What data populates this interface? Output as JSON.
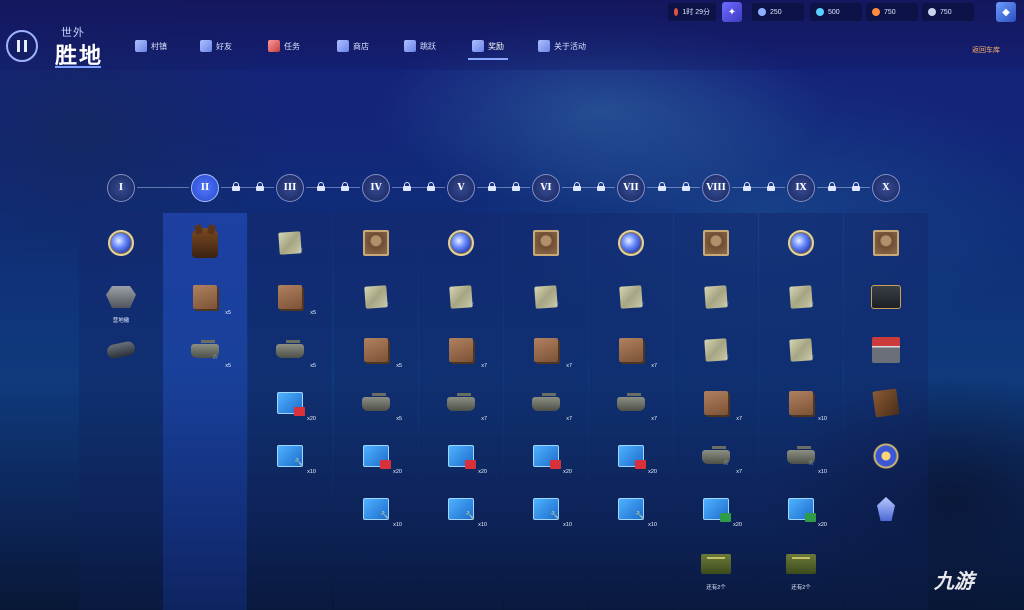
{
  "header": {
    "brand_sub": "世外",
    "brand_main": "胜地",
    "exit_label": "返回车库"
  },
  "nav": [
    {
      "label": "村镇",
      "icon": "village-icon"
    },
    {
      "label": "好友",
      "icon": "friends-icon"
    },
    {
      "label": "任务",
      "icon": "tasks-icon"
    },
    {
      "label": "商店",
      "icon": "shop-icon"
    },
    {
      "label": "跳跃",
      "icon": "jump-icon"
    },
    {
      "label": "奖励",
      "icon": "medal-icon",
      "active": true
    },
    {
      "label": "关于活动",
      "icon": "info-icon"
    }
  ],
  "resources": {
    "timer": "1时 29分",
    "res1": "250",
    "res2": "500",
    "res3": "750",
    "res4": "750"
  },
  "tiers": [
    "I",
    "II",
    "III",
    "IV",
    "V",
    "VI",
    "VII",
    "VIII",
    "IX",
    "X"
  ],
  "current_tier": "II",
  "columns": [
    {
      "tier": "I",
      "items": [
        {
          "type": "medal",
          "name": "medal-icon"
        },
        {
          "type": "emblem",
          "name": "emblem-icon",
          "label": "营地徽"
        },
        {
          "type": "barrel",
          "name": "barrel-icon"
        }
      ]
    },
    {
      "tier": "II",
      "items": [
        {
          "type": "dog",
          "name": "dog-icon"
        },
        {
          "type": "crate",
          "name": "crate-icon",
          "qty": "x5"
        },
        {
          "type": "tank",
          "name": "tank-icon",
          "qty": "x5",
          "star": true
        }
      ]
    },
    {
      "tier": "III",
      "items": [
        {
          "type": "map",
          "name": "map-icon",
          "star": true
        },
        {
          "type": "crate",
          "name": "crate-icon",
          "qty": "x5"
        },
        {
          "type": "tank",
          "name": "tank-icon",
          "qty": "x5"
        },
        {
          "type": "blueprint",
          "badge": "red",
          "name": "blueprint-icon",
          "qty": "x20"
        },
        {
          "type": "blueprint",
          "badge": "wrench",
          "name": "blueprint-wrench-icon",
          "qty": "x10"
        }
      ]
    },
    {
      "tier": "IV",
      "items": [
        {
          "type": "portrait",
          "name": "portrait-icon"
        },
        {
          "type": "map",
          "name": "map-icon",
          "star": true
        },
        {
          "type": "crate",
          "name": "crate-icon",
          "qty": "x5"
        },
        {
          "type": "tank",
          "name": "tank-icon",
          "qty": "x5"
        },
        {
          "type": "blueprint",
          "badge": "red",
          "name": "blueprint-icon",
          "qty": "x20"
        },
        {
          "type": "blueprint",
          "badge": "wrench",
          "name": "blueprint-wrench-icon",
          "qty": "x10"
        }
      ]
    },
    {
      "tier": "V",
      "items": [
        {
          "type": "medal",
          "name": "medal-icon"
        },
        {
          "type": "map",
          "name": "map-icon",
          "star": true
        },
        {
          "type": "crate",
          "name": "crate-icon",
          "qty": "x7"
        },
        {
          "type": "tank",
          "name": "tank-icon",
          "qty": "x7"
        },
        {
          "type": "blueprint",
          "badge": "red",
          "name": "blueprint-icon",
          "qty": "x20"
        },
        {
          "type": "blueprint",
          "badge": "wrench",
          "name": "blueprint-wrench-icon",
          "qty": "x10"
        }
      ]
    },
    {
      "tier": "VI",
      "items": [
        {
          "type": "portrait",
          "name": "portrait-icon"
        },
        {
          "type": "map",
          "name": "map-icon",
          "star": true
        },
        {
          "type": "crate",
          "name": "crate-icon",
          "qty": "x7"
        },
        {
          "type": "tank",
          "name": "tank-icon",
          "qty": "x7"
        },
        {
          "type": "blueprint",
          "badge": "red",
          "name": "blueprint-icon",
          "qty": "x20"
        },
        {
          "type": "blueprint",
          "badge": "wrench",
          "name": "blueprint-wrench-icon",
          "qty": "x10"
        }
      ]
    },
    {
      "tier": "VII",
      "items": [
        {
          "type": "medal",
          "name": "medal-icon"
        },
        {
          "type": "map",
          "name": "map-icon",
          "star": true
        },
        {
          "type": "crate",
          "name": "crate-icon",
          "qty": "x7"
        },
        {
          "type": "tank",
          "name": "tank-icon",
          "qty": "x7"
        },
        {
          "type": "blueprint",
          "badge": "red",
          "name": "blueprint-icon",
          "qty": "x20"
        },
        {
          "type": "blueprint",
          "badge": "wrench",
          "name": "blueprint-wrench-icon",
          "qty": "x10"
        }
      ]
    },
    {
      "tier": "VIII",
      "items": [
        {
          "type": "portrait",
          "name": "portrait-icon"
        },
        {
          "type": "map",
          "name": "map-icon",
          "star": true
        },
        {
          "type": "map",
          "name": "map-icon",
          "star": true
        },
        {
          "type": "crate",
          "name": "crate-icon",
          "qty": "x7"
        },
        {
          "type": "tank",
          "name": "tank-icon",
          "qty": "x7",
          "star": true
        },
        {
          "type": "blueprint",
          "badge": "green",
          "name": "blueprint-icon",
          "qty": "x20"
        },
        {
          "type": "ammo",
          "name": "ammo-box-icon",
          "label": "还有2个"
        }
      ]
    },
    {
      "tier": "IX",
      "items": [
        {
          "type": "medal",
          "name": "medal-icon"
        },
        {
          "type": "map",
          "name": "map-icon",
          "star": true
        },
        {
          "type": "map",
          "name": "map-icon",
          "star": true
        },
        {
          "type": "crate",
          "name": "crate-icon",
          "qty": "x10"
        },
        {
          "type": "tank",
          "name": "tank-icon",
          "qty": "x10",
          "star": true
        },
        {
          "type": "blueprint",
          "badge": "green",
          "name": "blueprint-icon",
          "qty": "x20"
        },
        {
          "type": "ammo",
          "name": "ammo-box-icon",
          "label": "还有2个"
        }
      ]
    },
    {
      "tier": "X",
      "items": [
        {
          "type": "portrait",
          "name": "portrait-icon"
        },
        {
          "type": "chest",
          "name": "chest-icon"
        },
        {
          "type": "shop",
          "name": "shop-icon"
        },
        {
          "type": "book",
          "name": "book-icon"
        },
        {
          "type": "snow",
          "name": "snowflake-badge-icon"
        },
        {
          "type": "gem",
          "name": "gem-icon"
        }
      ]
    }
  ],
  "watermark": "九游",
  "colors": {
    "accent": "#4f78ff",
    "exit": "#ffb36b",
    "bg": "#13247a"
  }
}
